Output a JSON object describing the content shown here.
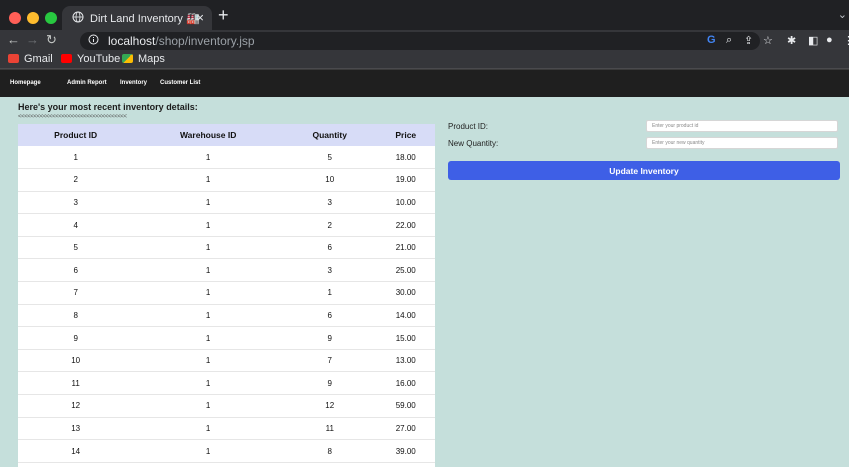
{
  "browser": {
    "tab_title": "Dirt Land Inventory 🏭",
    "tab_close": "×",
    "new_tab": "+",
    "url_host": "localhost",
    "url_path": "/shop/inventory.jsp",
    "bookmarks": [
      {
        "label": "Gmail",
        "icon": "gmail-icon",
        "color": "#ea4335"
      },
      {
        "label": "YouTube",
        "icon": "youtube-icon",
        "color": "#ff0000"
      },
      {
        "label": "Maps",
        "icon": "maps-icon",
        "color": "#34a853"
      }
    ]
  },
  "nav": {
    "items": [
      "Homepage",
      "Admin Report",
      "Inventory",
      "Customer List"
    ]
  },
  "main": {
    "heading": "Here's your most recent inventory details:",
    "back_arrows": "<<<<<<<<<<<<<<<<<<<<<<<<<<<<<<<<<<<"
  },
  "table": {
    "headers": [
      "Product ID",
      "Warehouse ID",
      "Quantity",
      "Price"
    ],
    "rows": [
      [
        "1",
        "1",
        "5",
        "18.00"
      ],
      [
        "2",
        "1",
        "10",
        "19.00"
      ],
      [
        "3",
        "1",
        "3",
        "10.00"
      ],
      [
        "4",
        "1",
        "2",
        "22.00"
      ],
      [
        "5",
        "1",
        "6",
        "21.00"
      ],
      [
        "6",
        "1",
        "3",
        "25.00"
      ],
      [
        "7",
        "1",
        "1",
        "30.00"
      ],
      [
        "8",
        "1",
        "6",
        "14.00"
      ],
      [
        "9",
        "1",
        "9",
        "15.00"
      ],
      [
        "10",
        "1",
        "7",
        "13.00"
      ],
      [
        "11",
        "1",
        "9",
        "16.00"
      ],
      [
        "12",
        "1",
        "12",
        "59.00"
      ],
      [
        "13",
        "1",
        "11",
        "27.00"
      ],
      [
        "14",
        "1",
        "8",
        "39.00"
      ]
    ]
  },
  "form": {
    "product_label": "Product ID:",
    "product_placeholder": "Enter your product id",
    "qty_label": "New Quantity:",
    "qty_placeholder": "Enter your new quantity",
    "button": "Update Inventory"
  },
  "colors": {
    "page_bg": "#c5dfdb",
    "button": "#3e5fe6",
    "table_header": "#d7dcf7"
  }
}
